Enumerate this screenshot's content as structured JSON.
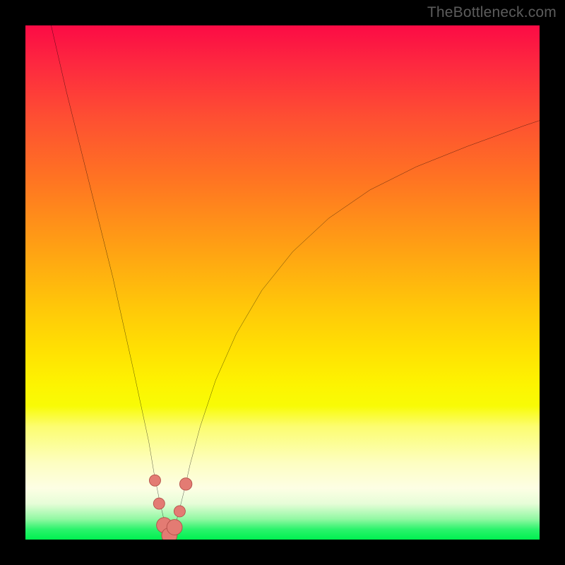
{
  "watermark": "TheBottleneck.com",
  "colors": {
    "frame": "#000000",
    "curve": "#000000",
    "marker_fill": "#e37b73",
    "marker_stroke": "#b24e47",
    "gradient_top": "#fc0b45",
    "gradient_bottom": "#00f050"
  },
  "chart_data": {
    "type": "line",
    "title": "",
    "xlabel": "",
    "ylabel": "",
    "xlim": [
      0,
      100
    ],
    "ylim": [
      0,
      100
    ],
    "grid": false,
    "note": "No axis tick labels or numeric annotations are visible; curve and marker positions are estimated from pixel geometry on a 0–100 normalized scale. y=0 is the bottom (green) edge, y=100 is the top (red) edge.",
    "series": [
      {
        "name": "curve",
        "x": [
          5,
          8,
          11,
          14,
          17,
          19,
          21,
          22.5,
          24,
          25,
          26,
          26.8,
          27.4,
          28,
          28.6,
          29.2,
          30,
          31,
          32,
          34,
          37,
          41,
          46,
          52,
          59,
          67,
          76,
          86,
          97,
          100
        ],
        "y": [
          100,
          87,
          75,
          63,
          51,
          42,
          33,
          26,
          19,
          13,
          8,
          4.5,
          2.2,
          0.8,
          1.4,
          3,
          6,
          10,
          14.5,
          22,
          31,
          40,
          48.5,
          56,
          62.5,
          68,
          72.5,
          76.5,
          80.5,
          81.5
        ]
      }
    ],
    "markers": [
      {
        "x": 25.2,
        "y": 11.5,
        "r": 1.1
      },
      {
        "x": 26.0,
        "y": 7.0,
        "r": 1.1
      },
      {
        "x": 27.0,
        "y": 2.8,
        "r": 1.5
      },
      {
        "x": 28.0,
        "y": 0.8,
        "r": 1.5
      },
      {
        "x": 29.0,
        "y": 2.4,
        "r": 1.5
      },
      {
        "x": 30.0,
        "y": 5.5,
        "r": 1.1
      },
      {
        "x": 31.2,
        "y": 10.8,
        "r": 1.2
      }
    ]
  }
}
